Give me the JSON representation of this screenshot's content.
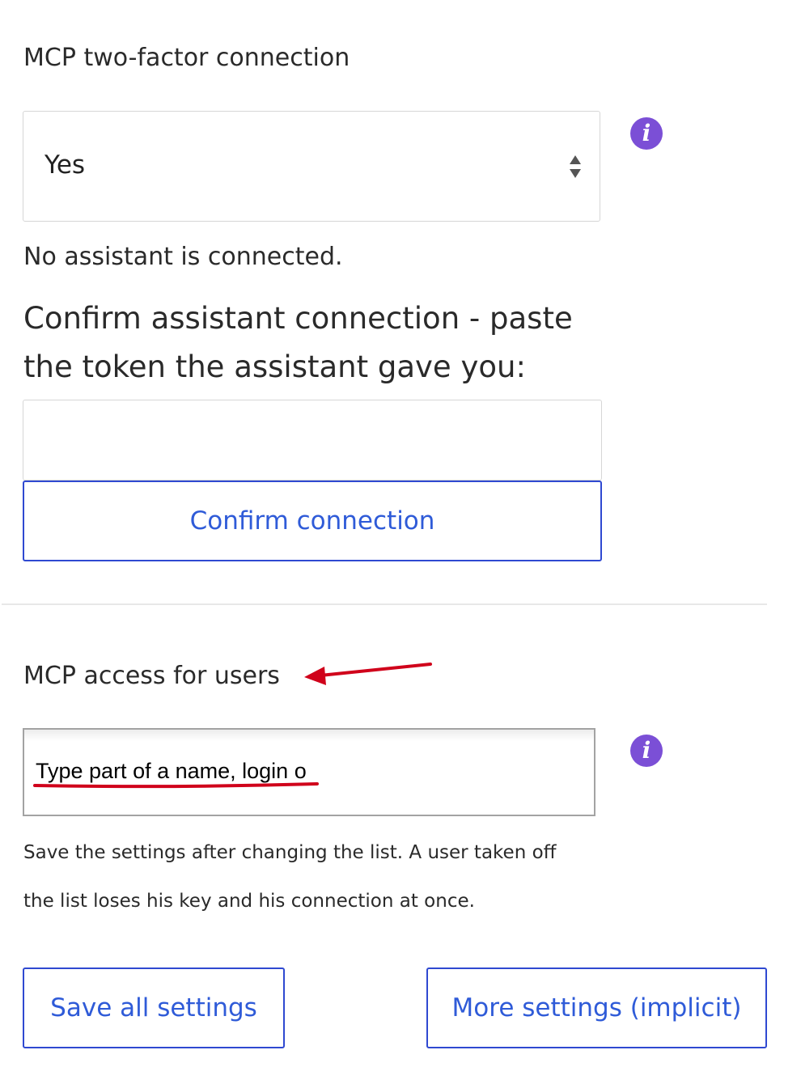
{
  "two_factor": {
    "title": "MCP two-factor connection",
    "select_value": "Yes",
    "status": "No assistant is connected.",
    "confirm_label": "Confirm assistant connection - paste the token the assistant gave you:",
    "token_value": "",
    "confirm_button": "Confirm connection"
  },
  "access": {
    "title": "MCP access for users",
    "input_placeholder": "Type part of a name, login o",
    "help_text": "Save the settings after changing the list. A user taken off the list loses his key and his connection at once."
  },
  "actions": {
    "save_label": "Save all settings",
    "more_label": "More settings (implicit)"
  },
  "colors": {
    "accent": "#2f49d1",
    "info_icon": "#7b4fd6",
    "annotation": "#d0021b"
  },
  "icons": {
    "info": "info-icon",
    "select": "sort-arrows-icon",
    "annotation": "red-arrow-annotation"
  }
}
